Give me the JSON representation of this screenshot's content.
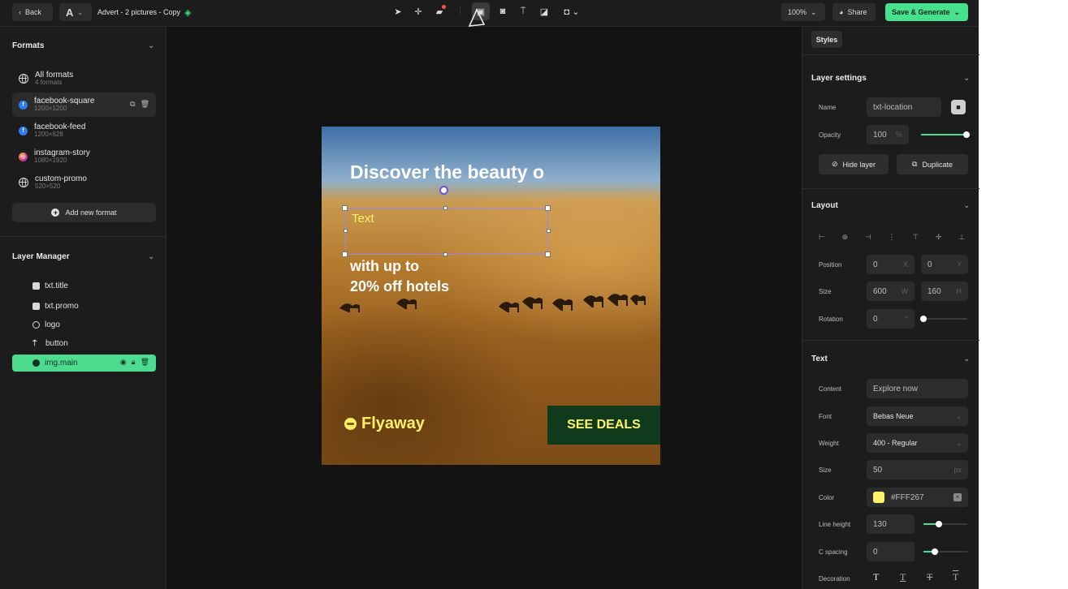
{
  "topbar": {
    "back_label": "Back",
    "font_letter": "A",
    "doc_title": "Advert - 2 pictures - Copy",
    "zoom": "100%",
    "share_label": "Share",
    "save_label": "Save & Generate"
  },
  "formats": {
    "heading": "Formats",
    "items": [
      {
        "name": "All formats",
        "sub": "4 formats",
        "icon": "globe-icon"
      },
      {
        "name": "facebook-square",
        "sub": "1200×1200",
        "icon": "facebook-icon"
      },
      {
        "name": "facebook-feed",
        "sub": "1200×628",
        "icon": "facebook-icon"
      },
      {
        "name": "instagram-story",
        "sub": "1080×1920",
        "icon": "instagram-icon"
      },
      {
        "name": "custom-promo",
        "sub": "520×520",
        "icon": "globe-icon"
      }
    ],
    "add_label": "Add new format"
  },
  "layers": {
    "heading": "Layer Manager",
    "items": [
      {
        "name": "txt.title",
        "icon": "text-layer-icon"
      },
      {
        "name": "txt.promo",
        "icon": "text-layer-icon"
      },
      {
        "name": "logo",
        "icon": "logo-layer-icon"
      },
      {
        "name": "button",
        "icon": "button-layer-icon"
      },
      {
        "name": "img.main",
        "icon": "image-layer-icon"
      }
    ]
  },
  "artboard": {
    "title": "Discover the beauty o",
    "selected_text": "Text",
    "promo_line1": "with up to",
    "promo_line2": "20% off hotels",
    "logo_text": "Flyaway",
    "cta": "SEE DEALS"
  },
  "styles_tab": "Styles",
  "layer_settings": {
    "heading": "Layer settings",
    "name_label": "Name",
    "name_value": "txt-location",
    "opacity_label": "Opacity",
    "opacity_value": "100",
    "opacity_unit": "%",
    "opacity_fraction": 1.0,
    "hide_label": "Hide layer",
    "duplicate_label": "Duplicate"
  },
  "layout": {
    "heading": "Layout",
    "position_label": "Position",
    "pos_x": "0",
    "pos_x_unit": "X",
    "pos_y": "0",
    "pos_y_unit": "Y",
    "size_label": "Size",
    "width": "600",
    "width_unit": "W",
    "height": "160",
    "height_unit": "H",
    "rotation_label": "Rotation",
    "rotation": "0",
    "rotation_unit": "°",
    "rotation_fraction": 0.0
  },
  "text": {
    "heading": "Text",
    "content_label": "Content",
    "content_placeholder": "Explore now",
    "font_label": "Font",
    "font_value": "Bebas Neue",
    "weight_label": "Weight",
    "weight_value": "400 - Regular",
    "size_label": "Size",
    "size_value": "50",
    "size_unit": "px",
    "color_label": "Color",
    "color_value": "#FFF267",
    "line_height_label": "Line height",
    "line_height_value": "130",
    "line_height_fraction": 0.35,
    "spacing_label": "C spacing",
    "spacing_value": "0",
    "spacing_fraction": 0.25,
    "decoration_label": "Decoration"
  },
  "colors": {
    "accent": "#46E08E",
    "cta_bg": "#0F3A1C",
    "brand_yellow": "#FFF267"
  }
}
